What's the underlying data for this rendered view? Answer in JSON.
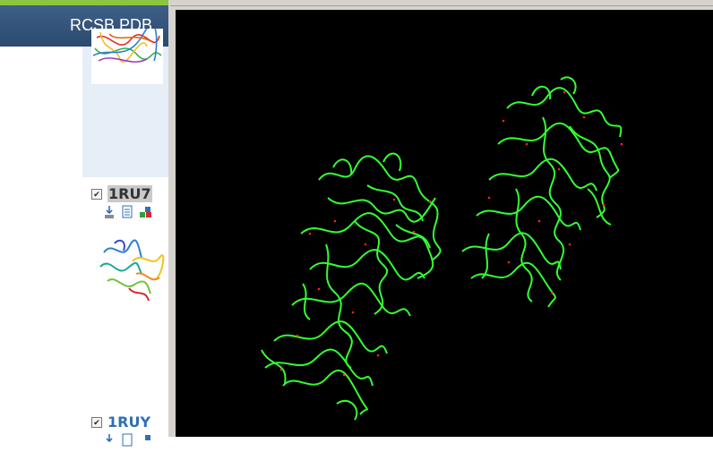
{
  "header": {
    "title": "RCSB PDB"
  },
  "results": [
    {
      "id": "1RU7",
      "checked": true,
      "selected": true
    },
    {
      "id": "1RUY",
      "checked": true,
      "selected": false
    }
  ],
  "icons": [
    "download-icon",
    "document-icon",
    "3d-view-icon"
  ],
  "viewer": {
    "background": "#000000",
    "trace_color": "#33ff33",
    "marker_color": "#ff2222"
  },
  "colors": {
    "header_bg": "#2c4a6e",
    "accent": "#8cc63f",
    "link": "#2f6fb5"
  }
}
